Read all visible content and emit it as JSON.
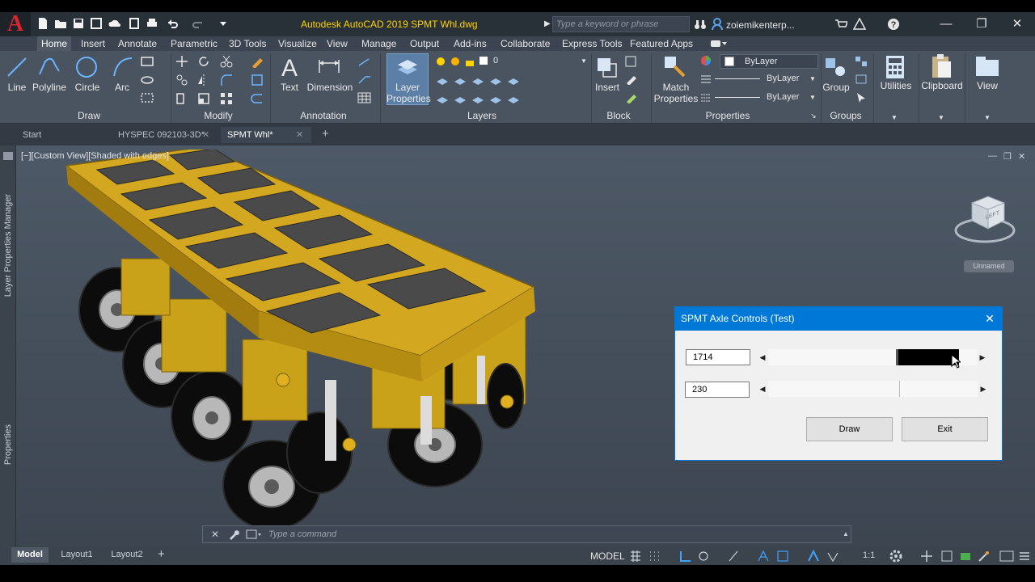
{
  "app": {
    "title": "Autodesk AutoCAD 2019   SPMT Whl.dwg",
    "logo": "A",
    "search_placeholder": "Type a keyword or phrase",
    "user": "zoiemikenterp..."
  },
  "ribbon_tabs": [
    "Home",
    "Insert",
    "Annotate",
    "Parametric",
    "3D Tools",
    "Visualize",
    "View",
    "Manage",
    "Output",
    "Add-ins",
    "Collaborate",
    "Express Tools",
    "Featured Apps"
  ],
  "draw": {
    "line": "Line",
    "polyline": "Polyline",
    "circle": "Circle",
    "arc": "Arc",
    "title": "Draw"
  },
  "modify": {
    "title": "Modify"
  },
  "annotation": {
    "text": "Text",
    "dimension": "Dimension",
    "title": "Annotation"
  },
  "layers": {
    "layer_properties": "Layer Properties",
    "current_layer": "0",
    "title": "Layers"
  },
  "block": {
    "insert": "Insert",
    "title": "Block"
  },
  "properties": {
    "match": "Match Properties",
    "color": "ByLayer",
    "linetype": "ByLayer",
    "lineweight": "ByLayer",
    "title": "Properties"
  },
  "groups": {
    "group": "Group",
    "title": "Groups"
  },
  "utilities": {
    "label": "Utilities"
  },
  "clipboard": {
    "label": "Clipboard"
  },
  "view": {
    "label": "View"
  },
  "doc_tabs": [
    "Start",
    "HYSPEC 092103-3D*",
    "SPMT Whl*"
  ],
  "viewport": {
    "label": "[−][Custom View][Shaded with edges]",
    "viewcube_face": "LEFT",
    "ucs_name": "Unnamed"
  },
  "side_palettes": {
    "layer_manager": "Layer Properties Manager",
    "properties": "Properties"
  },
  "command": {
    "placeholder": "Type a command"
  },
  "layout_tabs": [
    "Model",
    "Layout1",
    "Layout2"
  ],
  "status": {
    "space": "MODEL",
    "scale": "1:1"
  },
  "dialog": {
    "title": "SPMT Axle Controls (Test)",
    "field1": "1714",
    "field2": "230",
    "slider1_level": 0.88,
    "slider2_level": 0.65,
    "draw_button": "Draw",
    "exit_button": "Exit"
  },
  "colors": {
    "accent": "#0078d7",
    "title_text": "#ffd200",
    "model": "#d4a720",
    "logo": "#d8262e"
  }
}
